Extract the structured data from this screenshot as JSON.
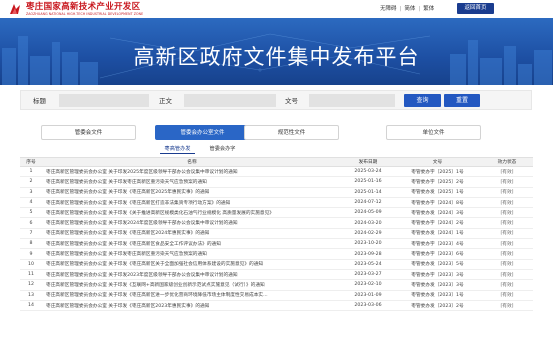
{
  "header": {
    "logo_cn": "枣庄国家高新技术产业开发区",
    "logo_en": "ZAOZHUANG NATIONAL HIGH-TECH INDUSTRIAL DEVELOPMENT ZONE",
    "links": [
      "无障碍",
      "简体",
      "繁体"
    ],
    "home_button": "返回首页"
  },
  "banner": {
    "title": "高新区政府文件集中发布平台"
  },
  "search": {
    "title_label": "标题",
    "body_label": "正文",
    "number_label": "文号",
    "query_button": "查询",
    "reset_button": "重置"
  },
  "tabs": [
    {
      "label": "管委会文件"
    },
    {
      "label": "管委会办公室文件"
    },
    {
      "label": "规范性文件"
    },
    {
      "label": "单位文件"
    }
  ],
  "subtabs": [
    {
      "label": "枣高管办发"
    },
    {
      "label": "管委会办字"
    }
  ],
  "table": {
    "headers": [
      "序号",
      "名称",
      "发布日期",
      "文号",
      "效力状态"
    ],
    "rows": [
      [
        "1",
        "枣庄高新区管理委员会办公室 关于印发2025年度区级领导干部办公会议集中审议计划的通知",
        "2025-03-24",
        "枣管委办字〔2025〕1号",
        "[有效]"
      ],
      [
        "2",
        "枣庄高新区管理委员会办公室 关于印发枣庄高新区重污染天气应急预案的通知",
        "2025-01-16",
        "枣管委办字〔2025〕2号",
        "[有效]"
      ],
      [
        "3",
        "枣庄高新区管理委员会办公室 关于印发《枣庄高新区2025年惠民实事》的通知",
        "2025-01-14",
        "枣管委办发〔2025〕1号",
        "[有效]"
      ],
      [
        "4",
        "枣庄高新区管理委员会办公室 关于印发《枣庄高新区打造非法集资专项行动方案》的通知",
        "2024-07-12",
        "枣管委办字〔2024〕8号",
        "[有效]"
      ],
      [
        "5",
        "枣庄高新区管理委员会办公室 关于印发《关于推进高新区规模类化石油气行业规模化 高质量发展的实施意见》",
        "2024-05-09",
        "枣管委办发〔2024〕3号",
        "[有效]"
      ],
      [
        "6",
        "枣庄高新区管理委员会办公室 关于印发2024年度区级领导干部办公会议集中审议计划的通知",
        "2024-03-20",
        "枣管委办字〔2024〕2号",
        "[有效]"
      ],
      [
        "7",
        "枣庄高新区管理委员会办公室 关于印发《枣庄高新区2024年惠民实事》的通知",
        "2024-02-29",
        "枣管委办发〔2024〕1号",
        "[有效]"
      ],
      [
        "8",
        "枣庄高新区管理委员会办公室 关于印发《枣庄高新区食品安全工作评议办法》的通知",
        "2023-10-20",
        "枣管委办字〔2023〕4号",
        "[有效]"
      ],
      [
        "9",
        "枣庄高新区管理委员会办公室 关于印发枣庄高新区重污染天气应急预案的通知",
        "2023-09-28",
        "枣管委办字〔2023〕6号",
        "[有效]"
      ],
      [
        "10",
        "枣庄高新区管理委员会办公室 关于印发《枣庄高新区关于全面加强社会信用体系建设的实施意见》的通知",
        "2023-05-24",
        "枣管委办发〔2023〕5号",
        "[有效]"
      ],
      [
        "11",
        "枣庄高新区管理委员会办公室 关于印发2023年度区级领导干部办公会议集中审议计划的通知",
        "2023-03-27",
        "枣管委办字〔2023〕3号",
        "[有效]"
      ],
      [
        "12",
        "枣庄高新区管理委员会办公室 关于印发《互联网+高新国家级创业创新示范试点实施意见（试行）》的通知",
        "2023-02-10",
        "枣管委办发〔2023〕3号",
        "[有效]"
      ],
      [
        "13",
        "枣庄高新区管理委员会办公室 关于印发《枣庄高新区进一步优化营商环境降低市场主体制度性交易成本实...",
        "2023-01-09",
        "枣管委办发〔2023〕1号",
        "[有效]"
      ],
      [
        "14",
        "枣庄高新区管理委员会办公室 关于印发《枣庄高新区2023年惠民实事》的通知",
        "2023-03-06",
        "枣管委办发〔2023〕2号",
        "[有效]"
      ]
    ]
  },
  "colors": {
    "brand_red": "#c8161d",
    "navy": "#1a3c8f",
    "accent_blue": "#2a66c6"
  }
}
